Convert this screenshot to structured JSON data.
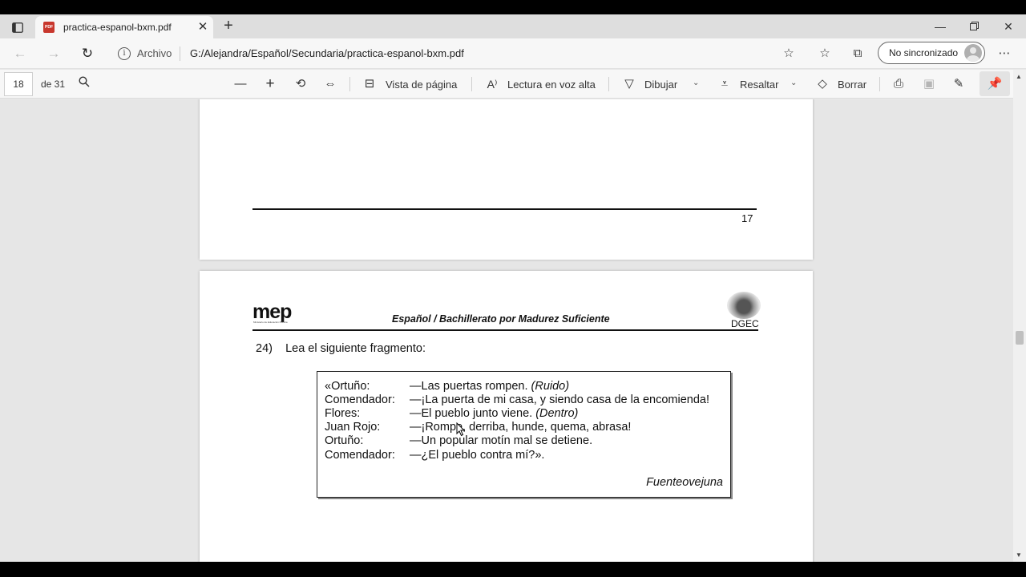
{
  "window": {
    "tab_title": "practica-espanol-bxm.pdf",
    "tab_favicon_text": "PDF",
    "tab_close_icon": "close-icon",
    "new_tab_icon": "plus-icon",
    "minimize_icon": "minimize-icon",
    "restore_icon": "restore-icon",
    "close_icon": "close-icon"
  },
  "addressbar": {
    "site_label": "Archivo",
    "url": "G:/Alejandra/Español/Secundaria/practica-espanol-bxm.pdf",
    "sync_label": "No sincronizado"
  },
  "pdf_toolbar": {
    "current_page": "18",
    "total_pages": "de 31",
    "page_view_label": "Vista de página",
    "read_aloud_label": "Lectura en voz alta",
    "draw_label": "Dibujar",
    "highlight_label": "Resaltar",
    "erase_label": "Borrar"
  },
  "document": {
    "prev_page_number": "17",
    "logo_text": "mep",
    "logo_subtext": "Ministerio de Educación Pública",
    "header_title": "Español / Bachillerato por Madurez Suficiente",
    "seal_label": "DGEC",
    "question": "24)    Lea el siguiente fragmento:",
    "quote_lines": [
      {
        "speaker": "«Ortuño:",
        "text": "—Las puertas rompen.",
        "stage": "(Ruido)"
      },
      {
        "speaker": "Comendador:",
        "text": "—¡La puerta de mi casa, y siendo casa de la encomienda!",
        "stage": ""
      },
      {
        "speaker": "Flores:",
        "text": "—El pueblo junto viene.",
        "stage": "(Dentro)"
      },
      {
        "speaker": "Juan Rojo:",
        "text": "—¡Rompe, derriba, hunde, quema, abrasa!",
        "stage": ""
      },
      {
        "speaker": "Ortuño:",
        "text": "—Un popular motín mal se detiene.",
        "stage": ""
      },
      {
        "speaker": "Comendador:",
        "text": "—¿El pueblo contra mí?».",
        "stage": ""
      }
    ],
    "quote_source": "Fuenteovejuna"
  }
}
